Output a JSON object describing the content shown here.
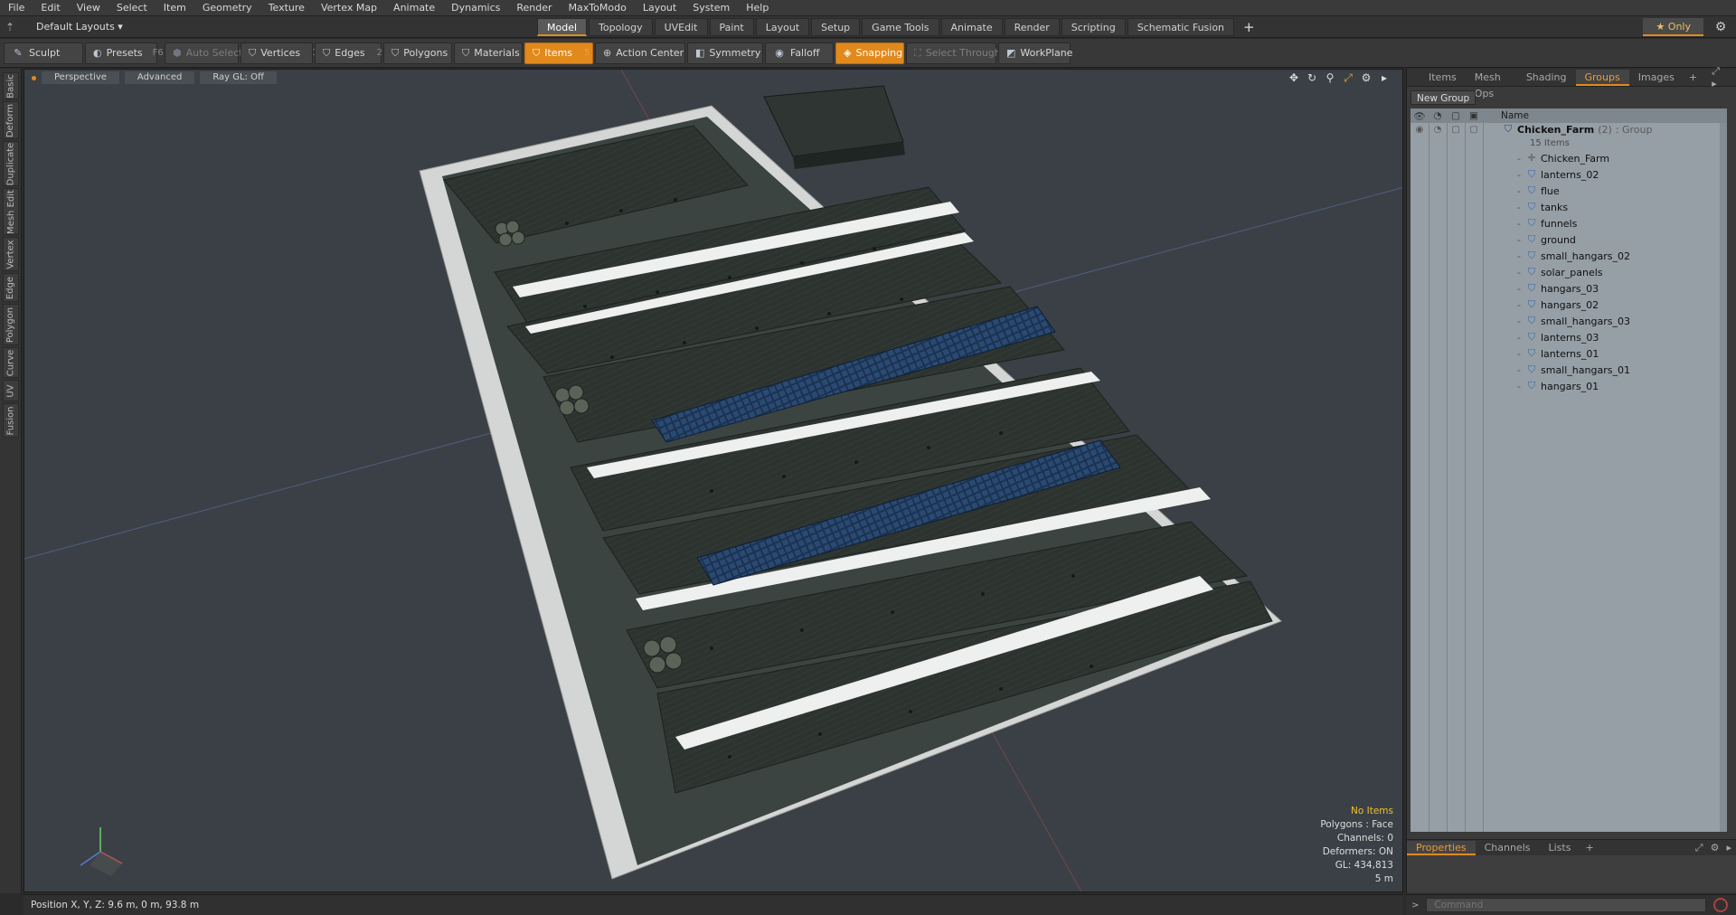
{
  "menu": [
    "File",
    "Edit",
    "View",
    "Select",
    "Item",
    "Geometry",
    "Texture",
    "Vertex Map",
    "Animate",
    "Dynamics",
    "Render",
    "MaxToModo",
    "Layout",
    "System",
    "Help"
  ],
  "layout_select": "Default Layouts ▾",
  "layout_tabs": [
    {
      "label": "Model",
      "active": true
    },
    {
      "label": "Topology",
      "active": false
    },
    {
      "label": "UVEdit",
      "active": false
    },
    {
      "label": "Paint",
      "active": false
    },
    {
      "label": "Layout",
      "active": false
    },
    {
      "label": "Setup",
      "active": false
    },
    {
      "label": "Game Tools",
      "active": false
    },
    {
      "label": "Animate",
      "active": false
    },
    {
      "label": "Render",
      "active": false
    },
    {
      "label": "Scripting",
      "active": false
    },
    {
      "label": "Schematic Fusion",
      "active": false
    }
  ],
  "only_button": "★  Only",
  "toolbar": {
    "sculpt": "Sculpt",
    "presets": "Presets",
    "presets_key": "F6",
    "auto_select": "Auto Select",
    "vertices": "Vertices",
    "vertices_num": "1",
    "edges": "Edges",
    "edges_num": "2",
    "polygons": "Polygons",
    "materials": "Materials",
    "items": "Items",
    "items_num": "5",
    "action_center": "Action Center",
    "symmetry": "Symmetry",
    "falloff": "Falloff",
    "snapping": "Snapping",
    "select_through": "Select Through",
    "workplane": "WorkPlane"
  },
  "left_tabs": [
    "Basic",
    "Deform",
    "Duplicate",
    "Mesh Edit",
    "Vertex",
    "Edge",
    "Polygon",
    "Curve",
    "UV",
    "Fusion"
  ],
  "viewport": {
    "view_mode": "Perspective",
    "shading": "Advanced",
    "raygl": "Ray GL: Off",
    "status": {
      "selection": "No Items",
      "polygons": "Polygons : Face",
      "channels": "Channels: 0",
      "deformers": "Deformers: ON",
      "gl": "GL: 434,813",
      "scale": "5 m"
    }
  },
  "right_panel": {
    "tabs": [
      {
        "label": "Items",
        "active": false
      },
      {
        "label": "Mesh Ops",
        "active": false
      },
      {
        "label": "Shading",
        "active": false
      },
      {
        "label": "Groups",
        "active": true
      },
      {
        "label": "Images",
        "active": false
      }
    ],
    "new_group": "New Group",
    "name_header": "Name",
    "group": {
      "name": "Chicken_Farm",
      "count": "(2)",
      "type": ": Group",
      "items_label": "15 Items"
    },
    "children": [
      {
        "name": "Chicken_Farm",
        "kind": "locator"
      },
      {
        "name": "lanterns_02",
        "kind": "mesh"
      },
      {
        "name": "flue",
        "kind": "mesh"
      },
      {
        "name": "tanks",
        "kind": "mesh"
      },
      {
        "name": "funnels",
        "kind": "mesh"
      },
      {
        "name": "ground",
        "kind": "mesh"
      },
      {
        "name": "small_hangars_02",
        "kind": "mesh"
      },
      {
        "name": "solar_panels",
        "kind": "mesh"
      },
      {
        "name": "hangars_03",
        "kind": "mesh"
      },
      {
        "name": "hangars_02",
        "kind": "mesh"
      },
      {
        "name": "small_hangars_03",
        "kind": "mesh"
      },
      {
        "name": "lanterns_03",
        "kind": "mesh"
      },
      {
        "name": "lanterns_01",
        "kind": "mesh"
      },
      {
        "name": "small_hangars_01",
        "kind": "mesh"
      },
      {
        "name": "hangars_01",
        "kind": "mesh"
      }
    ],
    "bottom_tabs": [
      {
        "label": "Properties",
        "active": true
      },
      {
        "label": "Channels",
        "active": false
      },
      {
        "label": "Lists",
        "active": false
      }
    ]
  },
  "bottom_status": "Position X, Y, Z:   9.6 m, 0 m, 93.8 m",
  "command_placeholder": "Command",
  "colors": {
    "accent": "#e08a1e",
    "viewport_bg": "#3a4045",
    "roof": "#2c3430",
    "concrete": "#d8dad8",
    "solar": "#1f3a5c"
  }
}
